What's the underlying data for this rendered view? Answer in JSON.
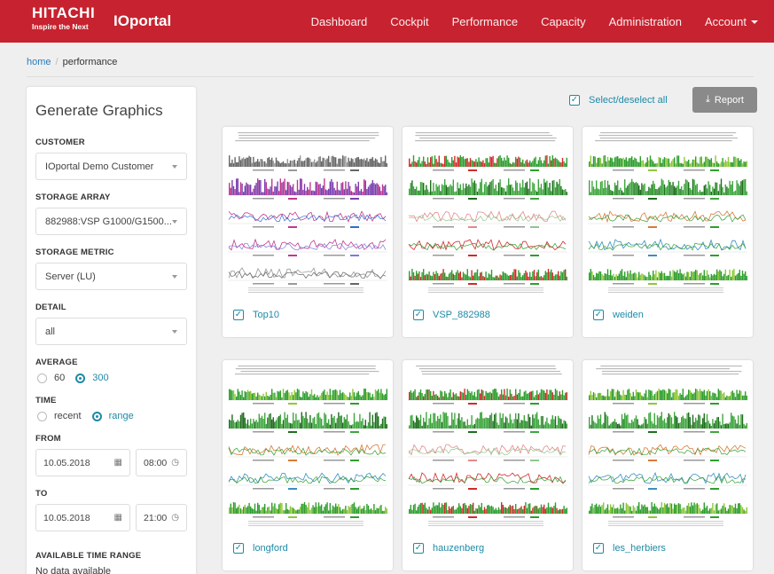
{
  "header": {
    "logo_line1": "HITACHI",
    "logo_line2": "Inspire the Next",
    "brand": "IOportal",
    "nav": [
      "Dashboard",
      "Cockpit",
      "Performance",
      "Capacity",
      "Administration",
      "Account"
    ]
  },
  "breadcrumb": {
    "home": "home",
    "separator": "/",
    "current": "performance"
  },
  "panel": {
    "title": "Generate Graphics",
    "customer": {
      "label": "CUSTOMER",
      "value": "IOportal Demo Customer"
    },
    "storage_array": {
      "label": "STORAGE ARRAY",
      "value": "882988:VSP G1000/G1500..."
    },
    "storage_metric": {
      "label": "STORAGE METRIC",
      "value": "Server (LU)"
    },
    "detail": {
      "label": "DETAIL",
      "value": "all"
    },
    "average": {
      "label": "AVERAGE",
      "options": [
        "60",
        "300"
      ],
      "selected": "300"
    },
    "time": {
      "label": "TIME",
      "options": [
        "recent",
        "range"
      ],
      "selected": "range"
    },
    "from": {
      "label": "FROM",
      "date": "10.05.2018",
      "time": "08:00"
    },
    "to": {
      "label": "TO",
      "date": "10.05.2018",
      "time": "21:00"
    },
    "available": {
      "label": "AVAILABLE TIME RANGE",
      "value": "No data available"
    }
  },
  "actions": {
    "select_all": "Select/deselect all",
    "report": "Report"
  },
  "cards": [
    {
      "name": "Top10",
      "checked": true,
      "style": "multi"
    },
    {
      "name": "VSP_882988",
      "checked": true,
      "style": "red"
    },
    {
      "name": "weiden",
      "checked": true,
      "style": "green"
    },
    {
      "name": "longford",
      "checked": true,
      "style": "green"
    },
    {
      "name": "hauzenberg",
      "checked": true,
      "style": "red"
    },
    {
      "name": "les_herbiers",
      "checked": true,
      "style": "green"
    }
  ],
  "colors": {
    "nav_bg": "#c7222f",
    "accent": "#1e8aa6",
    "report_btn": "#8a8a8a"
  }
}
